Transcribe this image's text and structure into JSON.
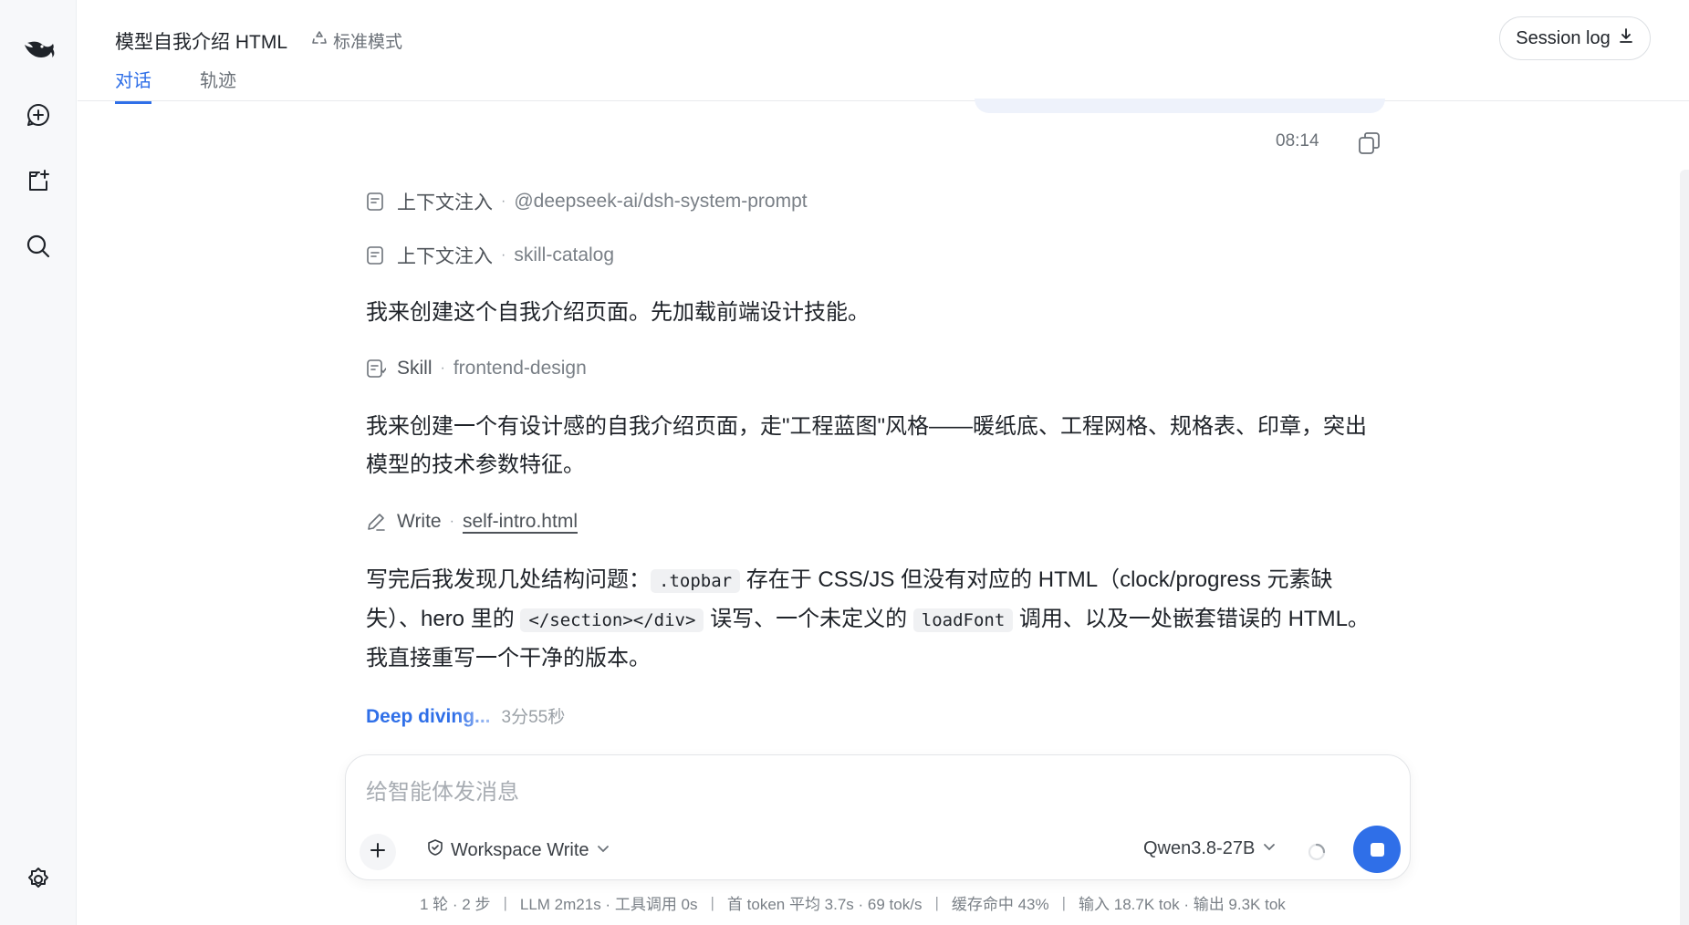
{
  "header": {
    "title": "模型自我介绍 HTML",
    "mode_label": "标准模式",
    "tabs": [
      {
        "label": "对话",
        "active": true
      },
      {
        "label": "轨迹",
        "active": false
      }
    ],
    "session_log_label": "Session log"
  },
  "sidebar": {
    "items": [
      {
        "icon": "deepseek-logo-icon"
      },
      {
        "icon": "new-chat-icon"
      },
      {
        "icon": "add-folder-icon"
      },
      {
        "icon": "search-icon"
      }
    ],
    "settings_icon": "gear-icon"
  },
  "message": {
    "timestamp": "08:14",
    "steps": [
      {
        "kind": "上下文注入",
        "detail": "@deepseek-ai/dsh-system-prompt",
        "icon": "document-icon"
      },
      {
        "kind": "上下文注入",
        "detail": "skill-catalog",
        "icon": "document-icon"
      },
      {
        "kind": "Skill",
        "detail": "frontend-design",
        "icon": "skill-icon"
      },
      {
        "kind": "Write",
        "detail": "self-intro.html",
        "icon": "pencil-icon"
      }
    ],
    "para1": "我来创建这个自我介绍页面。先加载前端设计技能。",
    "para2": "我来创建一个有设计感的自我介绍页面，走\"工程蓝图\"风格——暖纸底、工程网格、规格表、印章，突出模型的技术参数特征。",
    "para3": {
      "t1": "写完后我发现几处结构问题：",
      "c1": ".topbar",
      "t2": " 存在于 CSS/JS 但没有对应的 HTML（clock/progress 元素缺失）、hero 里的 ",
      "c2": "</section></div>",
      "t3": " 误写、一个未定义的 ",
      "c3": "loadFont",
      "t4": " 调用、以及一处嵌套错误的 HTML。我直接重写一个干净的版本。"
    },
    "thinking_label": "Deep diving...",
    "thinking_time": "3分55秒"
  },
  "composer": {
    "placeholder": "给智能体发消息",
    "permission_label": "Workspace Write",
    "model_label": "Qwen3.8-27B"
  },
  "stats": [
    "1 轮 · 2 步",
    "LLM 2m21s · 工具调用 0s",
    "首 token 平均 3.7s · 69 tok/s",
    "缓存命中 43%",
    "输入 18.7K tok · 输出 9.3K tok"
  ],
  "colors": {
    "accent": "#2f6fe8",
    "text": "#1f2329",
    "muted": "#7a8087"
  }
}
